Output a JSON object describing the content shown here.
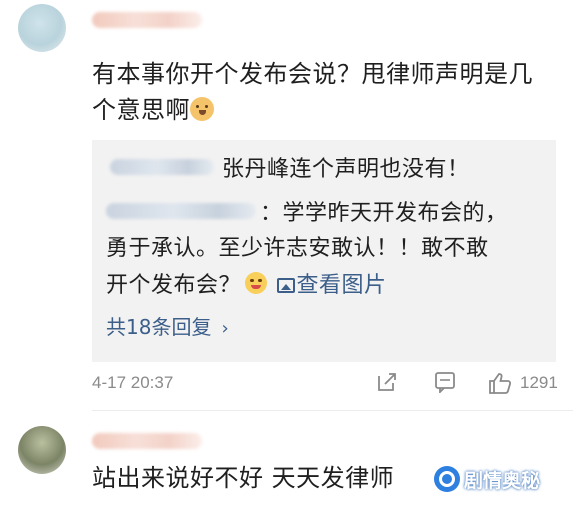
{
  "comment_main": {
    "text": "有本事你开个发布会说？甩律师声明是几个意思啊",
    "emoji": "doge-icon"
  },
  "reply_box": {
    "reply1": "张丹峰连个声明也没有！",
    "reply2_line1": "：学学昨天开发布会的，",
    "reply2_line2": "勇于承认。至少许志安敢认！！敢不敢",
    "reply2_line3": "开个发布会？",
    "view_picture": "查看图片",
    "more_replies": "共18条回复",
    "chevron": "›"
  },
  "meta": {
    "time": "4-17 20:37",
    "like_count": "1291"
  },
  "comment_second": {
    "text": "站出来说好不好 天天发律师"
  },
  "watermark": {
    "text": "剧情奥秘"
  },
  "colors": {
    "link": "#3c5f8a",
    "meta": "#8a8a8a",
    "reply_bg": "#f2f2f2"
  }
}
